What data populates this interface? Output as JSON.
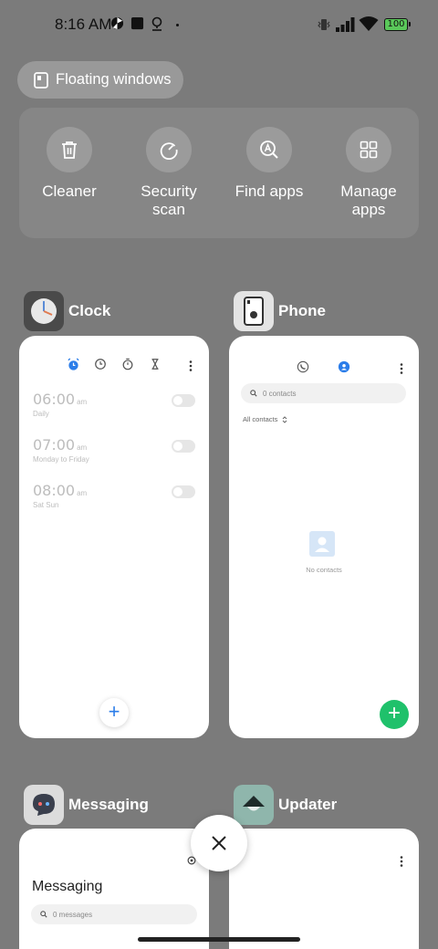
{
  "status_bar": {
    "time": "8:16 AM",
    "battery": "100",
    "icons": [
      "pinwheel-icon",
      "square-app-icon",
      "location-pin-icon",
      "vibrate-icon",
      "signal-icon",
      "wifi-icon",
      "battery-icon"
    ]
  },
  "floating_windows": {
    "label": "Floating windows",
    "icon": "floating-window-icon"
  },
  "quick_actions": [
    {
      "label": "Cleaner",
      "icon": "trash-icon"
    },
    {
      "label": "Security scan",
      "icon": "gauge-icon"
    },
    {
      "label": "Find apps",
      "icon": "magnify-a-icon"
    },
    {
      "label": "Manage apps",
      "icon": "grid-icon"
    }
  ],
  "apps": {
    "clock": {
      "name": "Clock",
      "alarms": [
        {
          "time": "06:00",
          "ampm": "am",
          "repeat": "Daily"
        },
        {
          "time": "07:00",
          "ampm": "am",
          "repeat": "Monday to Friday"
        },
        {
          "time": "08:00",
          "ampm": "am",
          "repeat": "Sat Sun"
        }
      ],
      "fab": "+"
    },
    "phone": {
      "name": "Phone",
      "search_placeholder": "0 contacts",
      "filter": "All contacts",
      "empty": "No contacts",
      "fab": "+"
    },
    "messaging": {
      "name": "Messaging",
      "title": "Messaging",
      "search_placeholder": "0 messages"
    },
    "updater": {
      "name": "Updater"
    }
  },
  "close_button": "close-icon",
  "colors": {
    "background": "#7b7b7b",
    "accent_blue": "#2b7de9",
    "accent_green": "#1fc16b"
  }
}
